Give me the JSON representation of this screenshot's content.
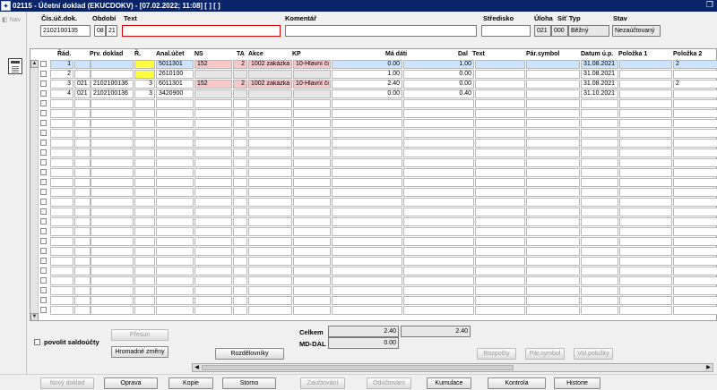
{
  "window": {
    "title": "02115 - Účetní doklad (EKUCDOKV) - [07.02.2022; 11:08]  [ ] [ ]",
    "restore_icon": "restore-icon"
  },
  "sidebar": {
    "nav_label": "Nav"
  },
  "header": {
    "labels": {
      "cis_dok": "Čís.úč.dok.",
      "obdobi": "Období",
      "text": "Text",
      "komentar": "Komentář",
      "stredisko": "Středisko",
      "uloha": "Úloha",
      "sit_typ": "Síť Typ",
      "stav": "Stav"
    },
    "values": {
      "cis_dok": "2102100135",
      "obdobi_mm": "08",
      "obdobi_yy": "21",
      "text": "",
      "komentar": "",
      "stredisko": "",
      "uloha": "021",
      "sit": "000",
      "typ": "Běžný",
      "stav": "Nezaúčtovaný"
    }
  },
  "grid": {
    "columns": [
      "Řád.",
      "Prv. doklad",
      "Ř.",
      "Anal.účet",
      "NS",
      "TA",
      "Akce",
      "KP",
      "Má dáti",
      "Dal",
      "Text",
      "Pár.symbol",
      "Datum ú.p.",
      "Položka 1",
      "Položka 2"
    ],
    "rows": [
      {
        "rad": "1",
        "prv_a": "",
        "prv_b": "",
        "r": "",
        "ucet": "5011301",
        "ns": "152",
        "ta": "2",
        "akce": "1002 zakázka",
        "kp": "10-Hlavní či",
        "ma_dati": "0.00",
        "dal": "1.00",
        "text": "",
        "par": "",
        "datum": "31.08.2021",
        "pol1": "",
        "pol2": "2"
      },
      {
        "rad": "2",
        "prv_a": "",
        "prv_b": "",
        "r": "",
        "ucet": "2610100",
        "ns": "",
        "ta": "",
        "akce": "",
        "kp": "",
        "ma_dati": "1.00",
        "dal": "0.00",
        "text": "",
        "par": "",
        "datum": "31.08.2021",
        "pol1": "",
        "pol2": ""
      },
      {
        "rad": "3",
        "prv_a": "021",
        "prv_b": "2102100136",
        "r": "3",
        "ucet": "6011301",
        "ns": "152",
        "ta": "2",
        "akce": "1002 zakázka",
        "kp": "10-Hlavní či",
        "ma_dati": "2.40",
        "dal": "0.00",
        "text": "",
        "par": "",
        "datum": "31.08.2021",
        "pol1": "",
        "pol2": "2"
      },
      {
        "rad": "4",
        "prv_a": "021",
        "prv_b": "2102100136",
        "r": "3",
        "ucet": "3420900",
        "ns": "",
        "ta": "",
        "akce": "",
        "kp": "",
        "ma_dati": "0.00",
        "dal": "0.40",
        "text": "",
        "par": "",
        "datum": "31.10.2021",
        "pol1": "",
        "pol2": ""
      }
    ]
  },
  "summary": {
    "celkem_label": "Celkem",
    "celkem_md": "2.40",
    "celkem_dal": "2.40",
    "mddal_label": "MD-DAL",
    "mddal_value": "0.00"
  },
  "options": {
    "povolit_saldoucty": "povolit saldoúčty"
  },
  "buttons": {
    "presun": "Přesun",
    "hromadne": "Hromadné změny",
    "rozdelovniky": "Rozdělovníky",
    "rozpocty": "Rozpočty",
    "par_symbol": "Pár.symbol",
    "vol_polozky": "Vol.položky",
    "novy": "Nový doklad",
    "oprava": "Oprava",
    "kopie": "Kopie",
    "storno": "Storno",
    "zauctovani": "Zaúčtování",
    "oductovani": "Odúčtování",
    "kumulace": "Kumulace",
    "kontrola": "Kontrola",
    "historie": "Historie"
  }
}
